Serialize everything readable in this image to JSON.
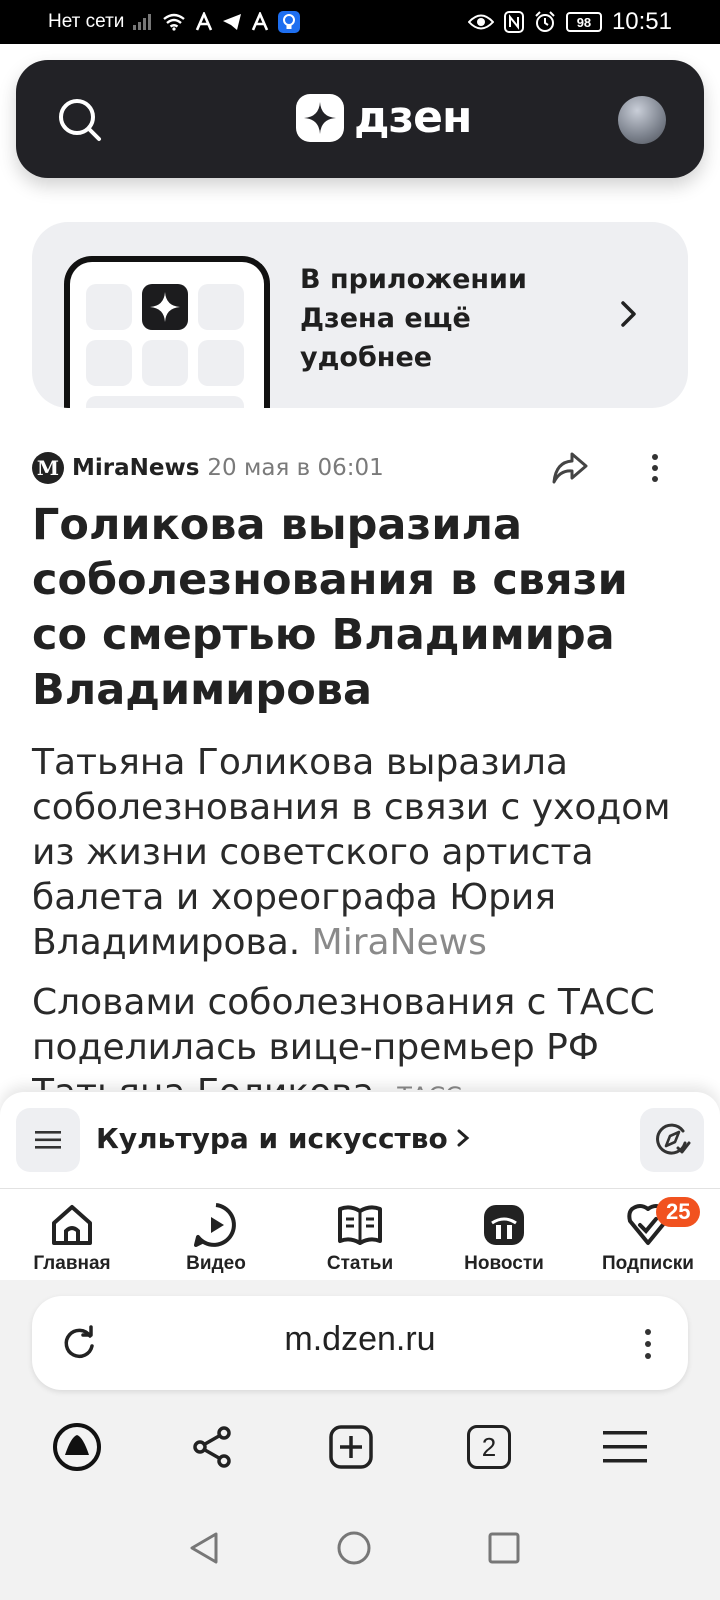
{
  "status_bar": {
    "network": "Нет сети",
    "battery": "98",
    "time": "10:51"
  },
  "header": {
    "logo_text": "дзен"
  },
  "promo": {
    "text": "В приложении Дзена ещё удобнее"
  },
  "article": {
    "source_initial": "M",
    "source_name": "MiraNews",
    "date": "20 мая в 06:01",
    "headline": "Голикова выразила соболезнования в связи со смертью Владимира Владимирова",
    "lead": "Татьяна Голикова выразила соболезнования в связи с уходом из жизни советского артиста балета и хореографа Юрия Владимирова.",
    "lead_source": "MiraNews",
    "para2": "Словами соболезнования с ТАСС поделилась вице-премьер РФ Татьяна Голикова.",
    "para2_source": "ТАСС"
  },
  "topic_bar": {
    "label": "Культура и искусство"
  },
  "tabs": [
    {
      "label": "Главная",
      "icon": "home-icon"
    },
    {
      "label": "Видео",
      "icon": "video-icon"
    },
    {
      "label": "Статьи",
      "icon": "articles-icon"
    },
    {
      "label": "Новости",
      "icon": "news-icon"
    },
    {
      "label": "Подписки",
      "icon": "subscriptions-icon",
      "badge": "25"
    }
  ],
  "browser": {
    "url": "m.dzen.ru",
    "tab_count": "2"
  },
  "colors": {
    "header_bg": "#222226",
    "badge": "#f1521f",
    "promo_bg": "#eeeff2"
  }
}
